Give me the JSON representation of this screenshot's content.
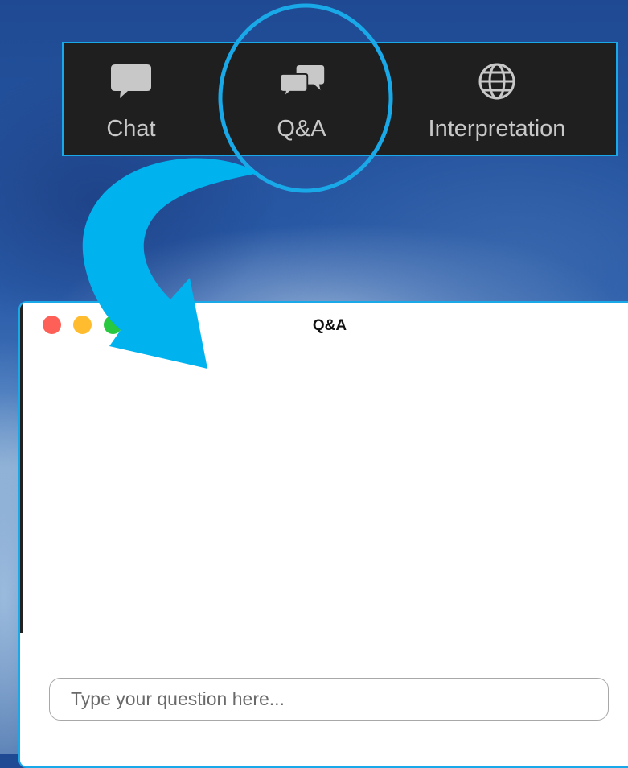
{
  "toolbar": {
    "buttons": [
      {
        "label": "Chat",
        "icon": "chat-bubble-icon"
      },
      {
        "label": "Q&A",
        "icon": "qa-bubbles-icon"
      },
      {
        "label": "Interpretation",
        "icon": "globe-icon"
      }
    ]
  },
  "qa_window": {
    "title": "Q&A",
    "input_placeholder": "Type your question here...",
    "input_value": ""
  },
  "colors": {
    "annotation_accent": "#1aa9e8",
    "toolbar_bg": "#1f1f1f",
    "toolbar_icon": "#c8c8c8",
    "traffic_close": "#fe5f57",
    "traffic_minimize": "#febc2e",
    "traffic_maximize": "#28c840"
  }
}
